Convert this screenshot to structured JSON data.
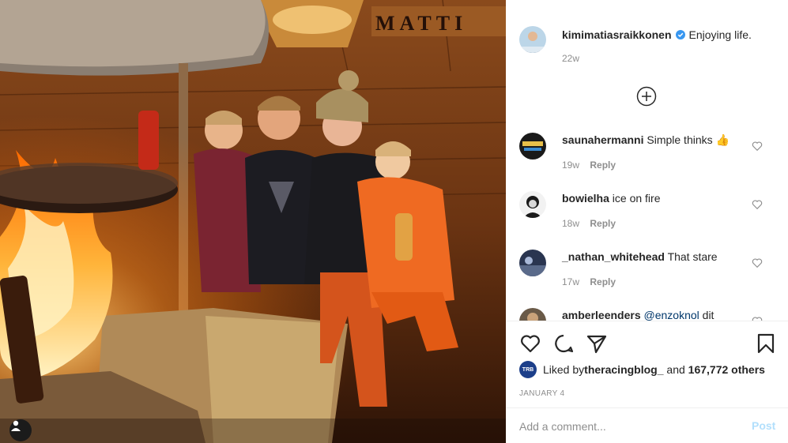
{
  "photo": {
    "sign_text": "MATTI",
    "user_tag_icon": "user-icon"
  },
  "post": {
    "author": "kimimatiasraikkonen",
    "verified": true,
    "caption": "Enjoying life.",
    "age": "22w",
    "load_more_icon": "plus-circle-icon"
  },
  "comments": [
    {
      "user": "saunahermanni",
      "text": "Simple thinks 👍",
      "age": "19w",
      "reply": "Reply"
    },
    {
      "user": "bowielha",
      "text": "ice on fire",
      "age": "18w",
      "reply": "Reply"
    },
    {
      "user": "_nathan_whitehead",
      "text": "That stare",
      "age": "17w",
      "reply": "Reply"
    },
    {
      "user": "amberleenders",
      "mention": "@enzoknol",
      "text": " dit",
      "age": "",
      "reply": ""
    }
  ],
  "actions": {
    "like_icon": "heart-icon",
    "comment_icon": "comment-icon",
    "share_icon": "share-icon",
    "save_icon": "bookmark-icon"
  },
  "likes": {
    "prefix": "Liked by ",
    "first_liker": "theracingblog_",
    "middle": " and ",
    "others": "167,772 others",
    "liker_avatar_text": "TRB"
  },
  "date": "JANUARY 4",
  "composer": {
    "placeholder": "Add a comment...",
    "post_label": "Post"
  }
}
